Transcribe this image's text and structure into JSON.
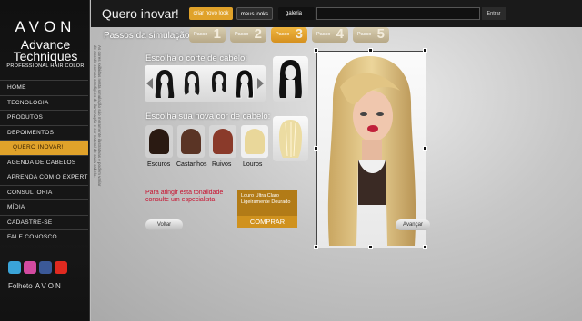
{
  "sidebar": {
    "brand": "AVON",
    "line1": "Advance",
    "line2": "Techniques",
    "line3": "PROFESSIONAL HAIR COLOR",
    "nav": [
      {
        "label": "HOME",
        "sub": false
      },
      {
        "label": "TECNOLOGIA",
        "sub": false
      },
      {
        "label": "PRODUTOS",
        "sub": false
      },
      {
        "label": "DEPOIMENTOS",
        "sub": false
      },
      {
        "label": "QUERO INOVAR!",
        "sub": true
      },
      {
        "label": "AGENDA DE CABELOS",
        "sub": false
      },
      {
        "label": "APRENDA COM O EXPERT",
        "sub": false
      },
      {
        "label": "CONSULTORIA",
        "sub": false
      },
      {
        "label": "MÍDIA",
        "sub": false
      },
      {
        "label": "CADASTRE-SE",
        "sub": false
      },
      {
        "label": "FALE CONOSCO",
        "sub": false
      }
    ],
    "social": [
      "twitter-icon",
      "orkut-icon",
      "facebook-icon",
      "youtube-icon"
    ],
    "folheto_label": "Folheto",
    "folheto_brand": "AVON",
    "vertical_note": "As cores exibidas nesta simulação são meramente ilustrativas e podem variar de acordo com as condições de iluminação e cor natural de cada cabelo."
  },
  "header": {
    "title": "Quero inovar!",
    "tab_create": "criar novo look",
    "tab_mylooks": "meus looks",
    "tab_gallery": "galeria",
    "enter_button": "Entrar"
  },
  "steps": {
    "label": "Passos da simulação",
    "items": [
      {
        "label": "Passo",
        "num": "1",
        "active": false
      },
      {
        "label": "Passo",
        "num": "2",
        "active": false
      },
      {
        "label": "Passo",
        "num": "3",
        "active": true
      },
      {
        "label": "Passo",
        "num": "4",
        "active": false
      },
      {
        "label": "Passo",
        "num": "5",
        "active": false
      }
    ]
  },
  "cut": {
    "label": "Escolha o corte de cabelo:"
  },
  "color": {
    "label": "Escolha sua nova cor de cabelo:",
    "swatches": [
      {
        "name": "Escuros",
        "color": "#2a1a12"
      },
      {
        "name": "Castanhos",
        "color": "#5a3425"
      },
      {
        "name": "Ruivos",
        "color": "#8a3a2a"
      },
      {
        "name": "Louros",
        "color": "#e9d79a"
      }
    ]
  },
  "warning": "Para atingir esta tonalidade consulte um especialista",
  "shade_name": "Louro Ultra Claro Ligeiramente Dourado",
  "buy_button": "COMPRAR",
  "back_button": "Voltar",
  "advance_button": "Avançar"
}
